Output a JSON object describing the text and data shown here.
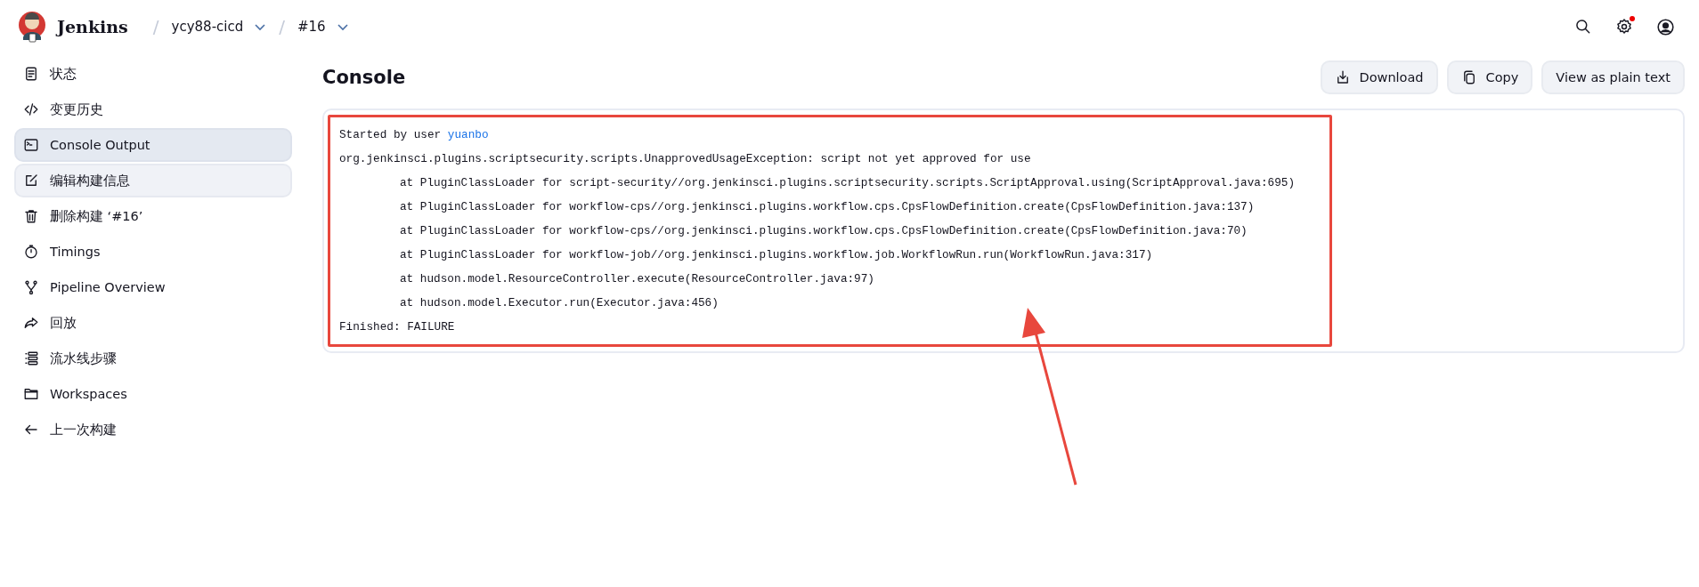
{
  "header": {
    "brand": "Jenkins",
    "breadcrumbs": [
      {
        "separator": "/",
        "label": "ycy88-cicd"
      },
      {
        "separator": "/",
        "label": "#16"
      }
    ],
    "notification_dot": true
  },
  "sidebar": {
    "items": [
      {
        "label": "状态",
        "kind": "document",
        "selected": false,
        "hovered": false
      },
      {
        "label": "变更历史",
        "kind": "code",
        "selected": false,
        "hovered": false
      },
      {
        "label": "Console Output",
        "kind": "terminal",
        "selected": true,
        "hovered": false
      },
      {
        "label": "编辑构建信息",
        "kind": "edit",
        "selected": false,
        "hovered": true
      },
      {
        "label": "删除构建 ‘#16’",
        "kind": "trash",
        "selected": false,
        "hovered": false
      },
      {
        "label": "Timings",
        "kind": "timer",
        "selected": false,
        "hovered": false
      },
      {
        "label": "Pipeline Overview",
        "kind": "branch",
        "selected": false,
        "hovered": false
      },
      {
        "label": "回放",
        "kind": "redo",
        "selected": false,
        "hovered": false
      },
      {
        "label": "流水线步骤",
        "kind": "list",
        "selected": false,
        "hovered": false
      },
      {
        "label": "Workspaces",
        "kind": "folder",
        "selected": false,
        "hovered": false
      },
      {
        "label": "上一次构建",
        "kind": "back",
        "selected": false,
        "hovered": false
      }
    ]
  },
  "console": {
    "title": "Console",
    "buttons": [
      {
        "label": "Download",
        "kind": "download"
      },
      {
        "label": "Copy",
        "kind": "copy"
      },
      {
        "label": "View as plain text",
        "kind": "plain"
      }
    ],
    "lines": [
      {
        "text": "Started by user ",
        "link": "yuanbo",
        "indented": false
      },
      {
        "text": "org.jenkinsci.plugins.scriptsecurity.scripts.UnapprovedUsageException: script not yet approved for use",
        "indented": false
      },
      {
        "text": "at PluginClassLoader for script-security//org.jenkinsci.plugins.scriptsecurity.scripts.ScriptApproval.using(ScriptApproval.java:695)",
        "indented": true
      },
      {
        "text": "at PluginClassLoader for workflow-cps//org.jenkinsci.plugins.workflow.cps.CpsFlowDefinition.create(CpsFlowDefinition.java:137)",
        "indented": true
      },
      {
        "text": "at PluginClassLoader for workflow-cps//org.jenkinsci.plugins.workflow.cps.CpsFlowDefinition.create(CpsFlowDefinition.java:70)",
        "indented": true
      },
      {
        "text": "at PluginClassLoader for workflow-job//org.jenkinsci.plugins.workflow.job.WorkflowRun.run(WorkflowRun.java:317)",
        "indented": true
      },
      {
        "text": "at hudson.model.ResourceController.execute(ResourceController.java:97)",
        "indented": true
      },
      {
        "text": "at hudson.model.Executor.run(Executor.java:456)",
        "indented": true
      },
      {
        "text": "Finished: FAILURE",
        "indented": false
      }
    ]
  },
  "annotation": {
    "color": "#e8473d"
  }
}
